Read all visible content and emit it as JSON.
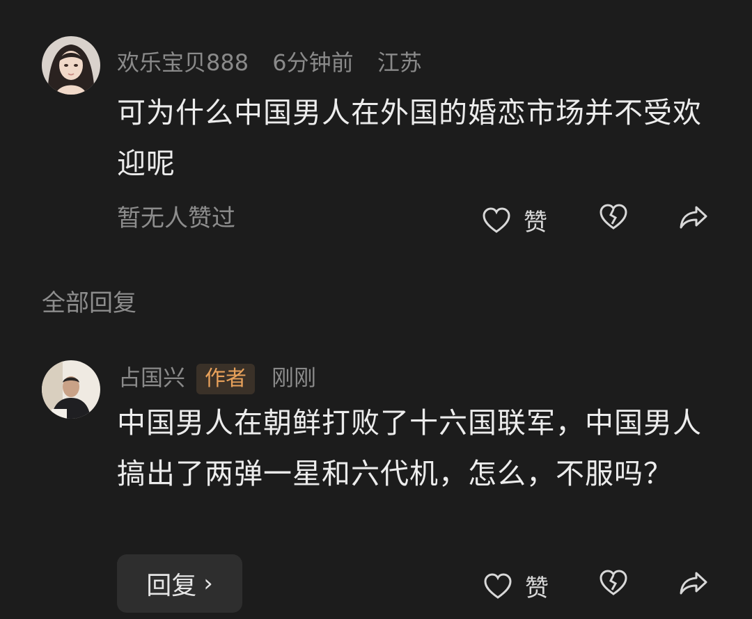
{
  "comment": {
    "username": "欢乐宝贝888",
    "time": "6分钟前",
    "location": "江苏",
    "text": "可为什么中国男人在外国的婚恋市场并不受欢迎呢",
    "likes_status": "暂无人赞过",
    "like_label": "赞",
    "icons": [
      "heart-icon",
      "broken-heart-icon",
      "share-icon"
    ]
  },
  "section": {
    "all_replies_label": "全部回复"
  },
  "reply": {
    "username": "占国兴",
    "badge": "作者",
    "time": "刚刚",
    "text": "中国男人在朝鲜打败了十六国联军，中国男人搞出了两弹一星和六代机，怎么，不服吗？",
    "reply_button_label": "回复",
    "reply_chevron": "›",
    "like_label": "赞"
  },
  "colors": {
    "background": "#1c1c1c",
    "badge_text": "#e9a25b",
    "badge_bg": "#3a3128"
  }
}
